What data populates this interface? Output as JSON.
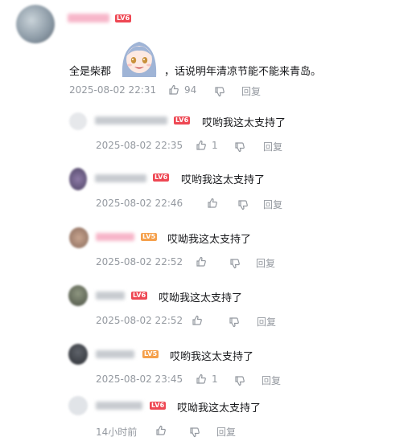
{
  "main_comment": {
    "text_before_sticker": "全是柴郡",
    "text_after_sticker": "，话说明年清凉节能不能来青岛。",
    "level": "LV6",
    "time": "2025-08-02 22:31",
    "likes": "94",
    "reply_label": "回复"
  },
  "replies": [
    {
      "level": "LV6",
      "text": "哎哟我这太支持了",
      "time": "2025-08-02 22:35",
      "likes": "1",
      "reply_label": "回复"
    },
    {
      "level": "LV6",
      "text": "哎哟我这太支持了",
      "time": "2025-08-02 22:46",
      "likes": "",
      "reply_label": "回复"
    },
    {
      "level": "LV5",
      "text": "哎呦我这太支持了",
      "time": "2025-08-02 22:52",
      "likes": "",
      "reply_label": "回复"
    },
    {
      "level": "LV6",
      "text": "哎呦我这太支持了",
      "time": "2025-08-02 22:52",
      "likes": "",
      "reply_label": "回复"
    },
    {
      "level": "LV5",
      "text": "哎哟我这太支持了",
      "time": "2025-08-02 23:45",
      "likes": "1",
      "reply_label": "回复"
    },
    {
      "level": "LV6",
      "text": "哎呦我这太支持了",
      "time": "14小时前",
      "likes": "",
      "reply_label": "回复"
    }
  ],
  "colors": {
    "text": "#18191c",
    "meta": "#9499a0",
    "lv6": "#ee4753",
    "lv5": "#f5a04b",
    "pink_name": "#fb7299"
  }
}
